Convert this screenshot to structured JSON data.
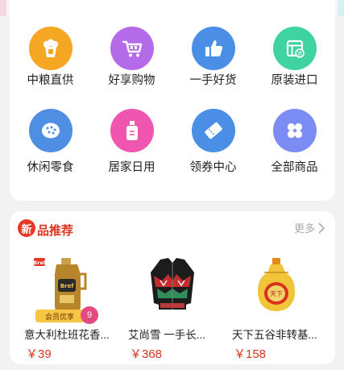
{
  "categories": [
    {
      "label": "中粮直供",
      "icon": "popcorn-icon",
      "color": "#f5a623"
    },
    {
      "label": "好享购物",
      "icon": "shopping-cart-icon",
      "color": "#b56be8"
    },
    {
      "label": "一手好货",
      "icon": "thumbs-up-icon",
      "color": "#4a8ee6"
    },
    {
      "label": "原装进口",
      "icon": "import-box-icon",
      "color": "#3fd3a0"
    },
    {
      "label": "休闲零食",
      "icon": "cookie-icon",
      "color": "#4f8fe3"
    },
    {
      "label": "居家日用",
      "icon": "detergent-bottle-icon",
      "color": "#f056b0"
    },
    {
      "label": "领券中心",
      "icon": "coupon-ticket-icon",
      "color": "#4a8ee6"
    },
    {
      "label": "全部商品",
      "icon": "grid-four-icon",
      "color": "#7b8cf5"
    }
  ],
  "new_products": {
    "badge": "新",
    "title": "品推荐",
    "more_label": "更多",
    "items": [
      {
        "name": "意大利杜班花香...",
        "price": "￥39",
        "image": "detergent-bottle-image",
        "tag": "会员优享",
        "tag_count": "9"
      },
      {
        "name": "艾尚雪 一手长...",
        "price": "￥368",
        "image": "patterned-coat-image"
      },
      {
        "name": "天下五谷非转基...",
        "price": "￥158",
        "image": "oil-bottle-image"
      }
    ]
  },
  "colors": {
    "accent": "#e03521",
    "price": "#d9321f"
  }
}
